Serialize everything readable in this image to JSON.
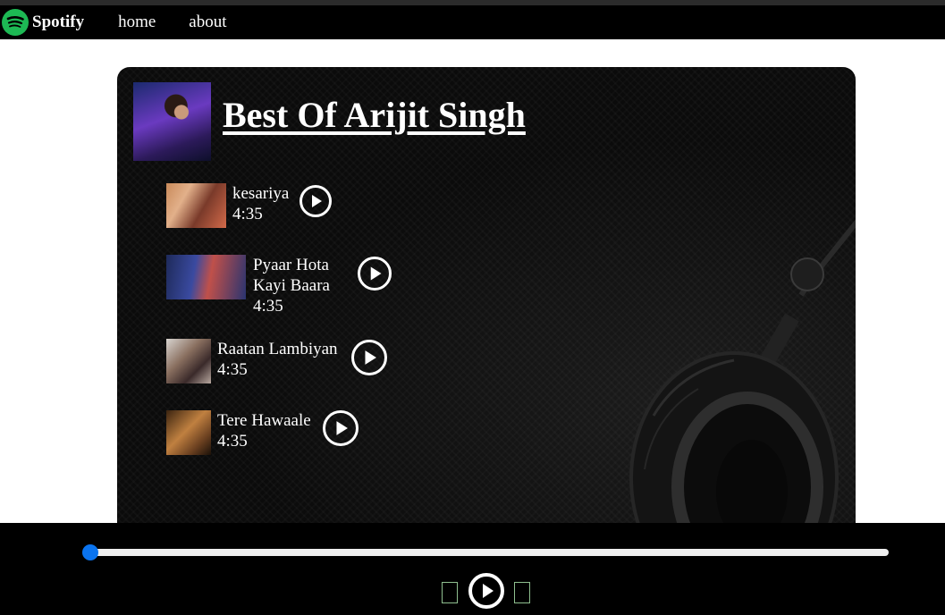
{
  "nav": {
    "brand": "Spotify",
    "links": [
      "home",
      "about"
    ]
  },
  "playlist": {
    "title": "Best Of Arijit Singh",
    "songs": [
      {
        "name": "kesariya",
        "duration": "4:35"
      },
      {
        "name_line1": "Pyaar Hota",
        "name_line2": "Kayi Baara",
        "duration": "4:35"
      },
      {
        "name": "Raatan Lambiyan",
        "duration": "4:35"
      },
      {
        "name": "Tere Hawaale",
        "duration": "4:35"
      }
    ]
  },
  "player": {
    "progress_fraction": 0.0,
    "controls": [
      "previous-icon",
      "play-icon",
      "next-icon"
    ]
  },
  "colors": {
    "brand_green": "#1DB954",
    "nav_bg": "#000000",
    "card_bg": "#0a0a0a",
    "slider_accent": "#0a74f0"
  }
}
